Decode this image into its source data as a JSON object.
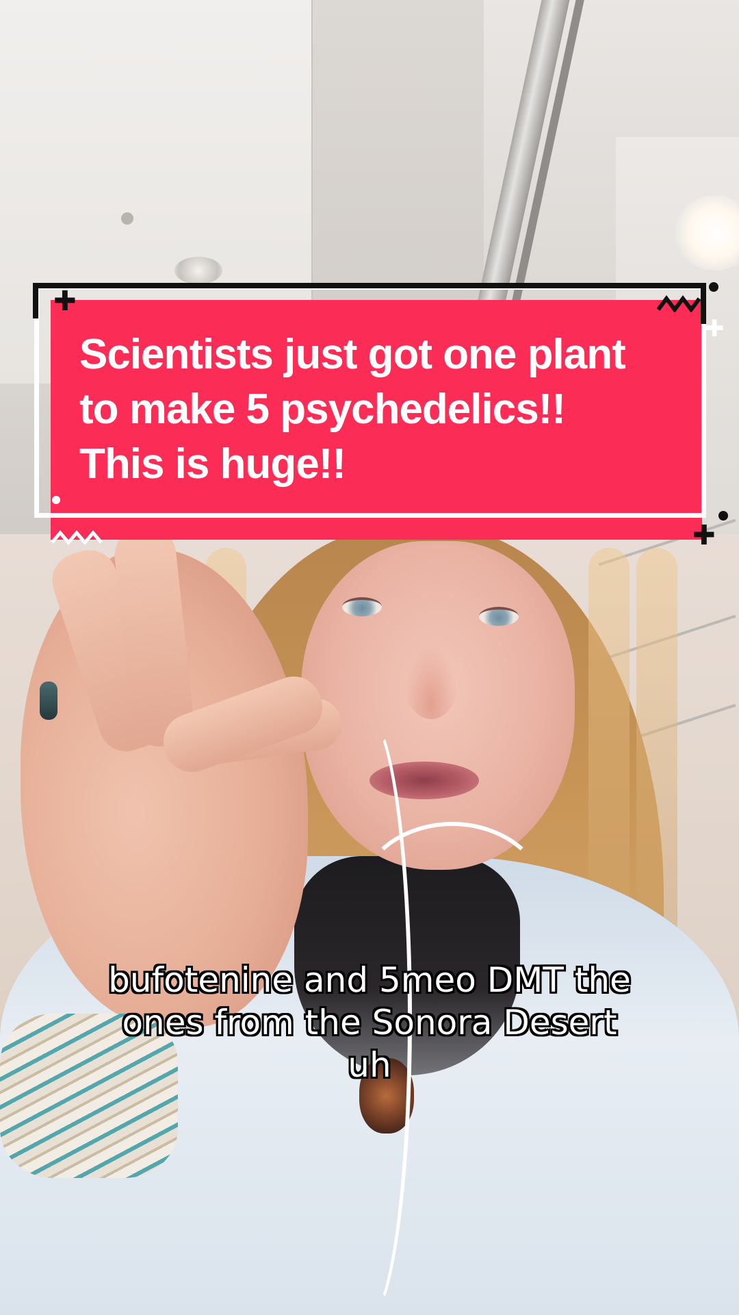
{
  "overlay": {
    "title_lines": [
      "Scientists just got one plant",
      "to make 5 psychedelics!!",
      "This is huge!!"
    ],
    "title_bg_color": "#fb2c55",
    "title_text_color": "#ffffff",
    "decorations": [
      "plus-icon",
      "zigzag-icon",
      "dot-icon"
    ]
  },
  "caption": {
    "lines": [
      "bufotenine and 5meo DMT the",
      "ones from the Sonora Desert",
      "uh"
    ]
  },
  "scene": {
    "subject": "woman-with-earphones",
    "accent_colors": {
      "hair": "#c79456",
      "sweater": "#dae3ec",
      "earphone_cord": "#ffffff"
    }
  }
}
